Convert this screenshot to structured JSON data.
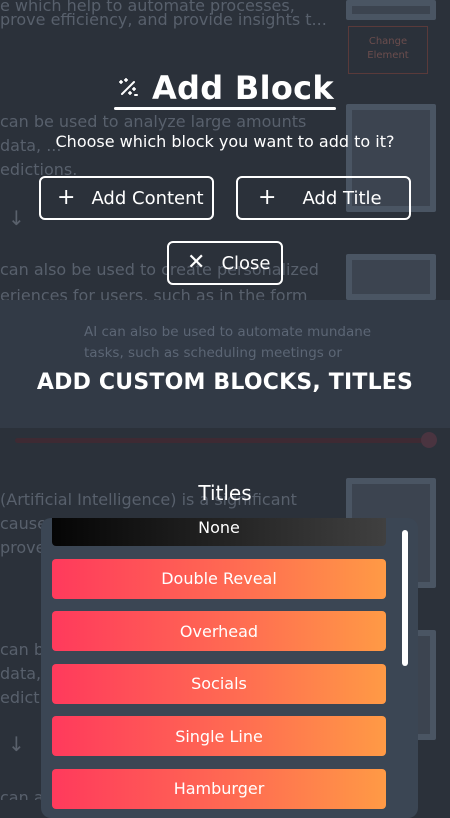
{
  "background": {
    "lines": [
      "e which help to automate processes,",
      "prove efficiency, and provide insights t...",
      "can be used to analyze large amounts",
      "data, ...",
      "edictions.",
      "can also be used to create personalized",
      "eriences for users, such as in the form",
      "(Artificial Intelligence) is a significant",
      "cause",
      "prove",
      "can b",
      "data,",
      "edicti",
      "can a"
    ],
    "band_caption_lines": [
      "AI can also be used to automate mundane",
      "tasks, such as scheduling meetings or"
    ],
    "orange_button_label": "Change Element"
  },
  "dialog": {
    "title": "Add Block",
    "title_icon": "sparkle-icon",
    "subtitle": "Choose which block you want to add to it?",
    "add_content_label": "Add Content",
    "add_title_label": "Add Title",
    "close_label": "Close"
  },
  "promo": {
    "headline": "ADD CUSTOM BLOCKS, TITLES"
  },
  "titles_sheet": {
    "heading": "Titles",
    "items": [
      {
        "label": "None"
      },
      {
        "label": "Double Reveal"
      },
      {
        "label": "Overhead"
      },
      {
        "label": "Socials"
      },
      {
        "label": "Single Line"
      },
      {
        "label": "Hamburger"
      }
    ]
  },
  "colors": {
    "accent_gradient_start": "#ff3a5c",
    "accent_gradient_end": "#ff9a45",
    "sheet_bg": "#3b4654",
    "page_bg": "#2b313a"
  }
}
